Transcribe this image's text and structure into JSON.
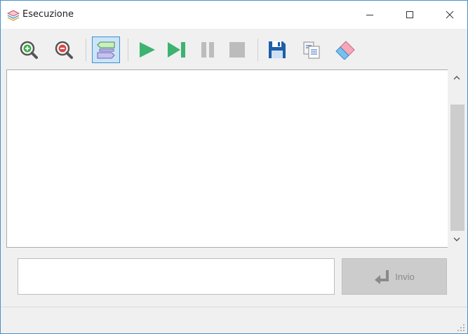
{
  "window": {
    "title": "Esecuzione",
    "icon": "app-stack-icon"
  },
  "toolbar": {
    "buttons": [
      {
        "name": "zoom-in",
        "icon": "zoom-in-icon"
      },
      {
        "name": "zoom-out",
        "icon": "zoom-out-icon"
      },
      {
        "name": "toggle-flow",
        "icon": "flow-shapes-icon",
        "active": true
      },
      {
        "name": "run",
        "icon": "play-icon"
      },
      {
        "name": "step",
        "icon": "step-forward-icon"
      },
      {
        "name": "pause",
        "icon": "pause-icon"
      },
      {
        "name": "stop",
        "icon": "stop-icon"
      },
      {
        "name": "save",
        "icon": "floppy-disk-icon"
      },
      {
        "name": "copy",
        "icon": "copy-icon"
      },
      {
        "name": "clear",
        "icon": "eraser-icon"
      }
    ]
  },
  "output": {
    "text": ""
  },
  "input": {
    "value": "",
    "placeholder": ""
  },
  "send": {
    "label": "Invio",
    "icon": "enter-arrow-icon",
    "enabled": false
  },
  "colors": {
    "accent": "#3d8fd1",
    "play_green": "#3cb371",
    "disabled_gray": "#bcbcbc",
    "floppy_blue": "#1d5fa8"
  }
}
